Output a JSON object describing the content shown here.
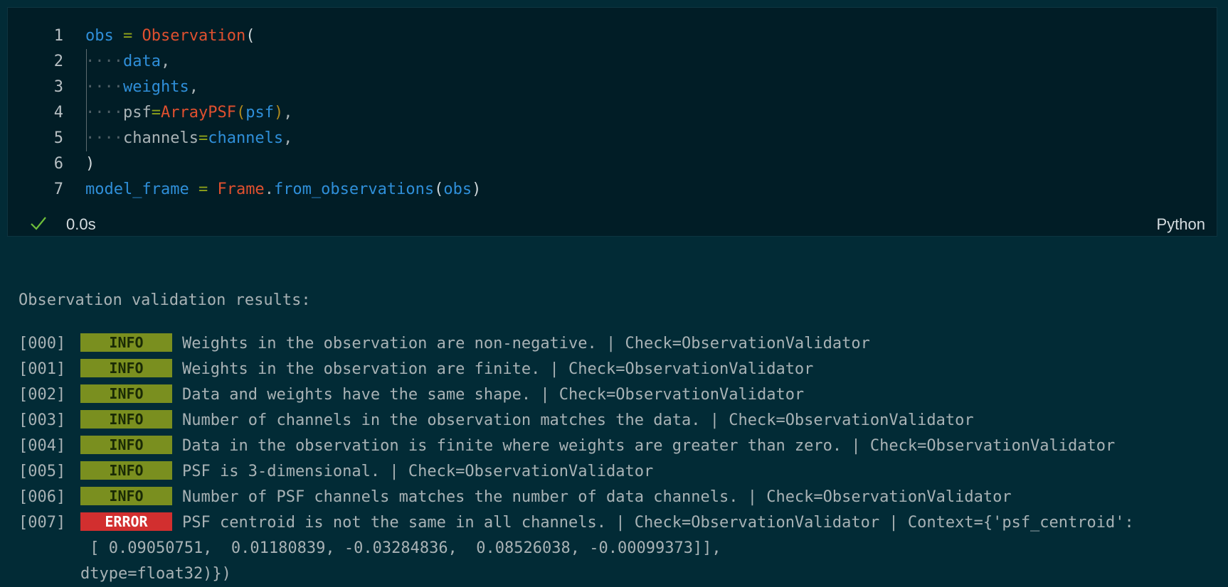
{
  "code": {
    "lines": [
      {
        "num": "1",
        "tokens": [
          [
            "obs",
            "var"
          ],
          [
            " = ",
            "op"
          ],
          [
            "Observation",
            "cls"
          ],
          [
            "(",
            "par"
          ]
        ]
      },
      {
        "num": "2",
        "tokens": [
          [
            "····",
            "dot"
          ],
          [
            "data",
            "var"
          ],
          [
            ",",
            "txt"
          ]
        ]
      },
      {
        "num": "3",
        "tokens": [
          [
            "····",
            "dot"
          ],
          [
            "weights",
            "var"
          ],
          [
            ",",
            "txt"
          ]
        ]
      },
      {
        "num": "4",
        "tokens": [
          [
            "····",
            "dot"
          ],
          [
            "psf",
            "txt"
          ],
          [
            "=",
            "op"
          ],
          [
            "ArrayPSF",
            "cls"
          ],
          [
            "(",
            "par2"
          ],
          [
            "psf",
            "var"
          ],
          [
            ")",
            "par2"
          ],
          [
            ",",
            "txt"
          ]
        ]
      },
      {
        "num": "5",
        "tokens": [
          [
            "····",
            "dot"
          ],
          [
            "channels",
            "txt"
          ],
          [
            "=",
            "op"
          ],
          [
            "channels",
            "var"
          ],
          [
            ",",
            "txt"
          ]
        ]
      },
      {
        "num": "6",
        "tokens": [
          [
            ")",
            "par"
          ]
        ]
      },
      {
        "num": "7",
        "tokens": [
          [
            "model_frame",
            "var"
          ],
          [
            " = ",
            "op"
          ],
          [
            "Frame",
            "cls"
          ],
          [
            ".",
            "txt"
          ],
          [
            "from_observations",
            "fn"
          ],
          [
            "(",
            "par"
          ],
          [
            "obs",
            "var"
          ],
          [
            ")",
            "par"
          ]
        ]
      }
    ]
  },
  "status": {
    "exec_time": "0.0s",
    "language": "Python",
    "icon": "checkmark-icon",
    "success_color": "#6fbf3a"
  },
  "output": {
    "header": "Observation validation results:",
    "entries": [
      {
        "index": "[000]",
        "level": "INFO",
        "message": "Weights in the observation are non-negative. | Check=ObservationValidator"
      },
      {
        "index": "[001]",
        "level": "INFO",
        "message": "Weights in the observation are finite. | Check=ObservationValidator"
      },
      {
        "index": "[002]",
        "level": "INFO",
        "message": "Data and weights have the same shape. | Check=ObservationValidator"
      },
      {
        "index": "[003]",
        "level": "INFO",
        "message": "Number of channels in the observation matches the data. | Check=ObservationValidator"
      },
      {
        "index": "[004]",
        "level": "INFO",
        "message": "Data in the observation is finite where weights are greater than zero. | Check=ObservationValidator"
      },
      {
        "index": "[005]",
        "level": "INFO",
        "message": "PSF is 3-dimensional. | Check=ObservationValidator"
      },
      {
        "index": "[006]",
        "level": "INFO",
        "message": "Number of PSF channels matches the number of data channels. | Check=ObservationValidator"
      },
      {
        "index": "[007]",
        "level": "ERROR",
        "message": "PSF centroid is not the same in all channels. | Check=ObservationValidator | Context={'psf_centroid':"
      }
    ],
    "continuation": [
      " [ 0.09050751,  0.01180839, -0.03284836,  0.08526038, -0.00099373]],",
      "dtype=float32)})"
    ],
    "colors": {
      "info_bg": "#7a8f1f",
      "error_bg": "#d22f2f"
    }
  }
}
